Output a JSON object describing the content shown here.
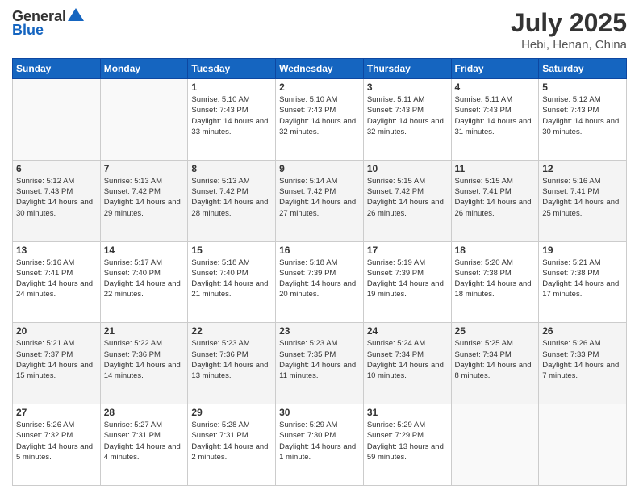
{
  "header": {
    "logo_general": "General",
    "logo_blue": "Blue",
    "month": "July 2025",
    "location": "Hebi, Henan, China"
  },
  "calendar": {
    "days_of_week": [
      "Sunday",
      "Monday",
      "Tuesday",
      "Wednesday",
      "Thursday",
      "Friday",
      "Saturday"
    ],
    "weeks": [
      [
        {
          "day": "",
          "empty": true
        },
        {
          "day": "",
          "empty": true
        },
        {
          "day": "1",
          "sunrise": "Sunrise: 5:10 AM",
          "sunset": "Sunset: 7:43 PM",
          "daylight": "Daylight: 14 hours and 33 minutes."
        },
        {
          "day": "2",
          "sunrise": "Sunrise: 5:10 AM",
          "sunset": "Sunset: 7:43 PM",
          "daylight": "Daylight: 14 hours and 32 minutes."
        },
        {
          "day": "3",
          "sunrise": "Sunrise: 5:11 AM",
          "sunset": "Sunset: 7:43 PM",
          "daylight": "Daylight: 14 hours and 32 minutes."
        },
        {
          "day": "4",
          "sunrise": "Sunrise: 5:11 AM",
          "sunset": "Sunset: 7:43 PM",
          "daylight": "Daylight: 14 hours and 31 minutes."
        },
        {
          "day": "5",
          "sunrise": "Sunrise: 5:12 AM",
          "sunset": "Sunset: 7:43 PM",
          "daylight": "Daylight: 14 hours and 30 minutes."
        }
      ],
      [
        {
          "day": "6",
          "sunrise": "Sunrise: 5:12 AM",
          "sunset": "Sunset: 7:43 PM",
          "daylight": "Daylight: 14 hours and 30 minutes."
        },
        {
          "day": "7",
          "sunrise": "Sunrise: 5:13 AM",
          "sunset": "Sunset: 7:42 PM",
          "daylight": "Daylight: 14 hours and 29 minutes."
        },
        {
          "day": "8",
          "sunrise": "Sunrise: 5:13 AM",
          "sunset": "Sunset: 7:42 PM",
          "daylight": "Daylight: 14 hours and 28 minutes."
        },
        {
          "day": "9",
          "sunrise": "Sunrise: 5:14 AM",
          "sunset": "Sunset: 7:42 PM",
          "daylight": "Daylight: 14 hours and 27 minutes."
        },
        {
          "day": "10",
          "sunrise": "Sunrise: 5:15 AM",
          "sunset": "Sunset: 7:42 PM",
          "daylight": "Daylight: 14 hours and 26 minutes."
        },
        {
          "day": "11",
          "sunrise": "Sunrise: 5:15 AM",
          "sunset": "Sunset: 7:41 PM",
          "daylight": "Daylight: 14 hours and 26 minutes."
        },
        {
          "day": "12",
          "sunrise": "Sunrise: 5:16 AM",
          "sunset": "Sunset: 7:41 PM",
          "daylight": "Daylight: 14 hours and 25 minutes."
        }
      ],
      [
        {
          "day": "13",
          "sunrise": "Sunrise: 5:16 AM",
          "sunset": "Sunset: 7:41 PM",
          "daylight": "Daylight: 14 hours and 24 minutes."
        },
        {
          "day": "14",
          "sunrise": "Sunrise: 5:17 AM",
          "sunset": "Sunset: 7:40 PM",
          "daylight": "Daylight: 14 hours and 22 minutes."
        },
        {
          "day": "15",
          "sunrise": "Sunrise: 5:18 AM",
          "sunset": "Sunset: 7:40 PM",
          "daylight": "Daylight: 14 hours and 21 minutes."
        },
        {
          "day": "16",
          "sunrise": "Sunrise: 5:18 AM",
          "sunset": "Sunset: 7:39 PM",
          "daylight": "Daylight: 14 hours and 20 minutes."
        },
        {
          "day": "17",
          "sunrise": "Sunrise: 5:19 AM",
          "sunset": "Sunset: 7:39 PM",
          "daylight": "Daylight: 14 hours and 19 minutes."
        },
        {
          "day": "18",
          "sunrise": "Sunrise: 5:20 AM",
          "sunset": "Sunset: 7:38 PM",
          "daylight": "Daylight: 14 hours and 18 minutes."
        },
        {
          "day": "19",
          "sunrise": "Sunrise: 5:21 AM",
          "sunset": "Sunset: 7:38 PM",
          "daylight": "Daylight: 14 hours and 17 minutes."
        }
      ],
      [
        {
          "day": "20",
          "sunrise": "Sunrise: 5:21 AM",
          "sunset": "Sunset: 7:37 PM",
          "daylight": "Daylight: 14 hours and 15 minutes."
        },
        {
          "day": "21",
          "sunrise": "Sunrise: 5:22 AM",
          "sunset": "Sunset: 7:36 PM",
          "daylight": "Daylight: 14 hours and 14 minutes."
        },
        {
          "day": "22",
          "sunrise": "Sunrise: 5:23 AM",
          "sunset": "Sunset: 7:36 PM",
          "daylight": "Daylight: 14 hours and 13 minutes."
        },
        {
          "day": "23",
          "sunrise": "Sunrise: 5:23 AM",
          "sunset": "Sunset: 7:35 PM",
          "daylight": "Daylight: 14 hours and 11 minutes."
        },
        {
          "day": "24",
          "sunrise": "Sunrise: 5:24 AM",
          "sunset": "Sunset: 7:34 PM",
          "daylight": "Daylight: 14 hours and 10 minutes."
        },
        {
          "day": "25",
          "sunrise": "Sunrise: 5:25 AM",
          "sunset": "Sunset: 7:34 PM",
          "daylight": "Daylight: 14 hours and 8 minutes."
        },
        {
          "day": "26",
          "sunrise": "Sunrise: 5:26 AM",
          "sunset": "Sunset: 7:33 PM",
          "daylight": "Daylight: 14 hours and 7 minutes."
        }
      ],
      [
        {
          "day": "27",
          "sunrise": "Sunrise: 5:26 AM",
          "sunset": "Sunset: 7:32 PM",
          "daylight": "Daylight: 14 hours and 5 minutes."
        },
        {
          "day": "28",
          "sunrise": "Sunrise: 5:27 AM",
          "sunset": "Sunset: 7:31 PM",
          "daylight": "Daylight: 14 hours and 4 minutes."
        },
        {
          "day": "29",
          "sunrise": "Sunrise: 5:28 AM",
          "sunset": "Sunset: 7:31 PM",
          "daylight": "Daylight: 14 hours and 2 minutes."
        },
        {
          "day": "30",
          "sunrise": "Sunrise: 5:29 AM",
          "sunset": "Sunset: 7:30 PM",
          "daylight": "Daylight: 14 hours and 1 minute."
        },
        {
          "day": "31",
          "sunrise": "Sunrise: 5:29 AM",
          "sunset": "Sunset: 7:29 PM",
          "daylight": "Daylight: 13 hours and 59 minutes."
        },
        {
          "day": "",
          "empty": true
        },
        {
          "day": "",
          "empty": true
        }
      ]
    ]
  }
}
